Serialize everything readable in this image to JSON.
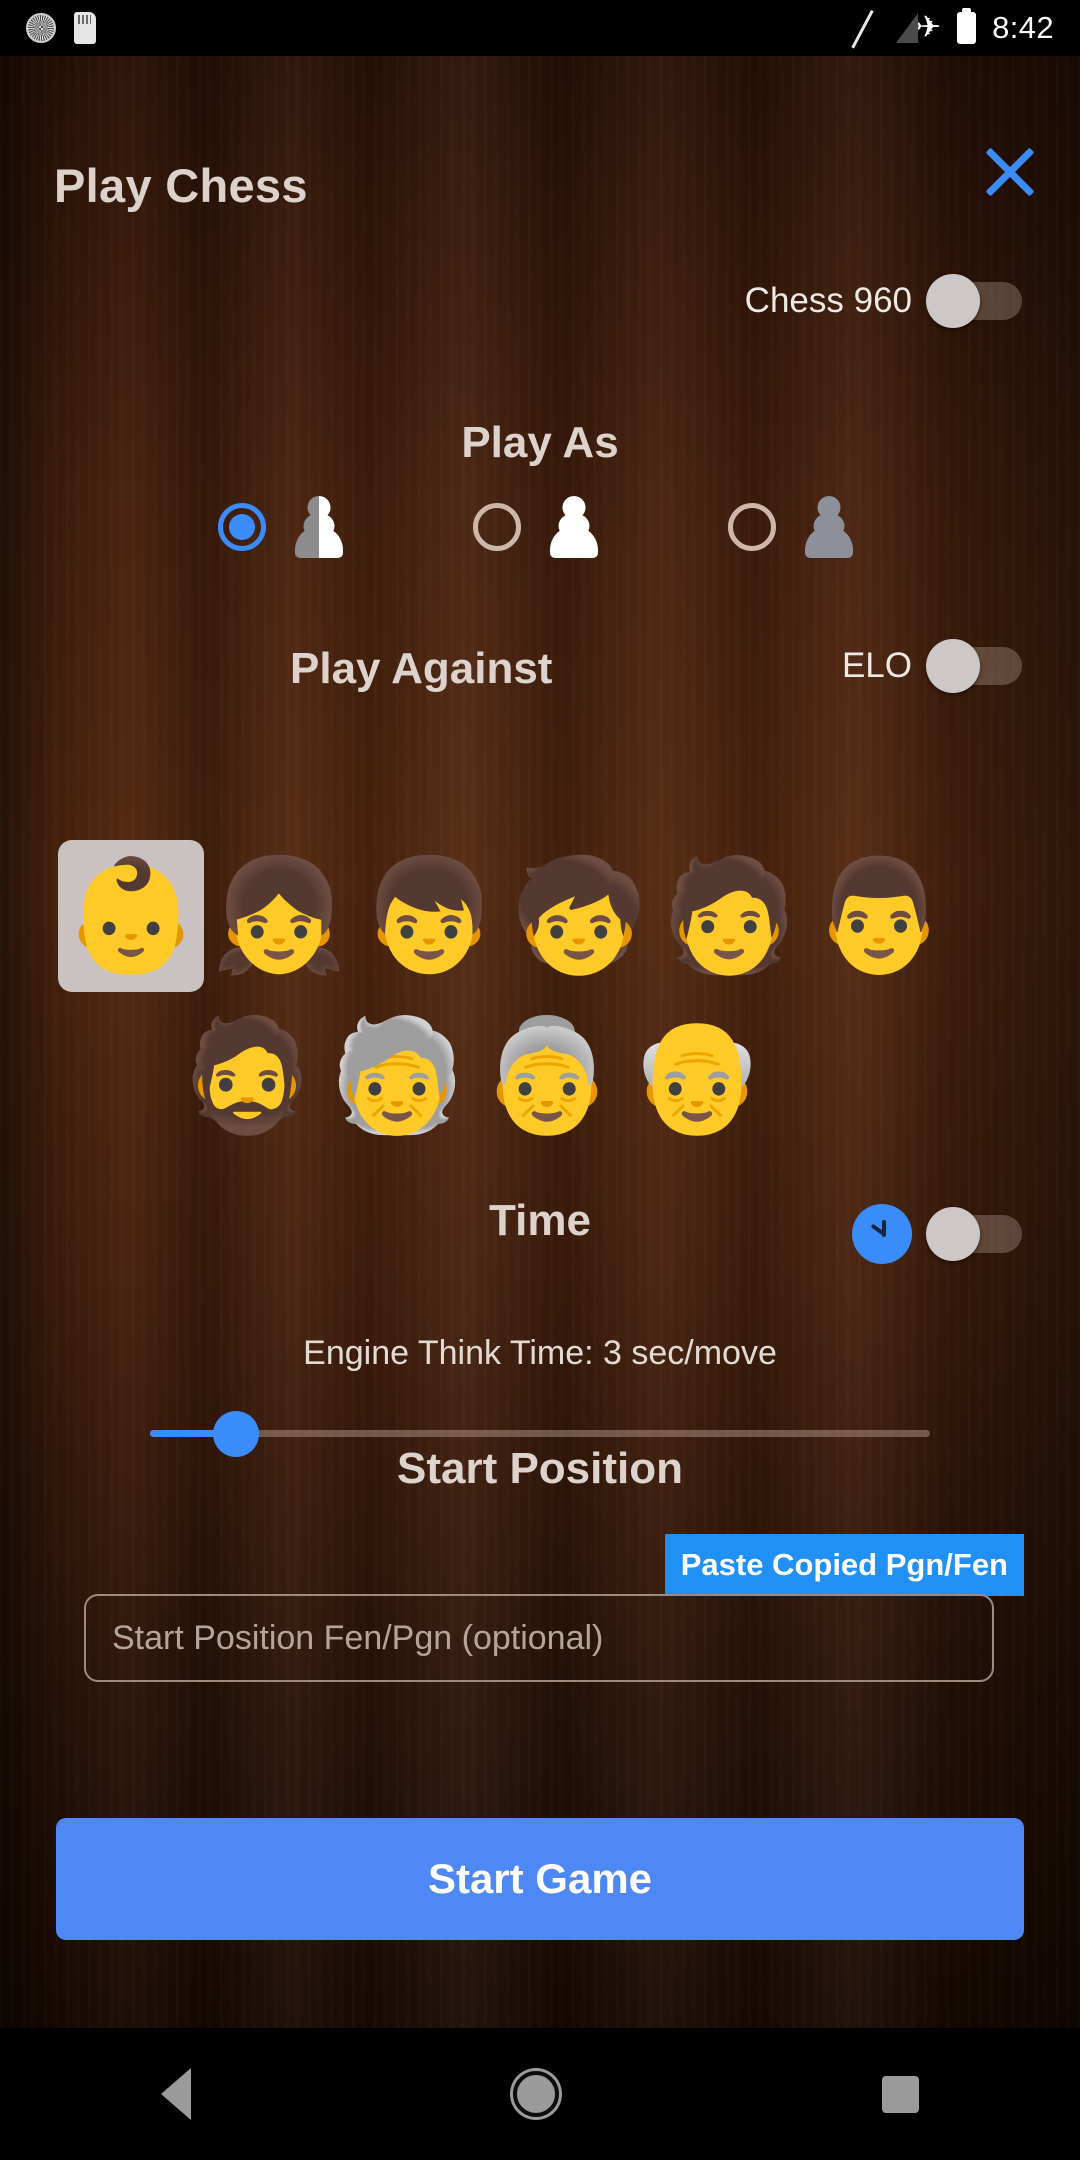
{
  "status_bar": {
    "icons": [
      "clock-icon",
      "sd-card-icon",
      "no-signal-icon",
      "airplane-mode-icon",
      "battery-icon"
    ],
    "time": "8:42"
  },
  "header": {
    "title": "Play Chess",
    "close_label": "✕"
  },
  "chess960": {
    "label": "Chess 960",
    "enabled": false
  },
  "play_as": {
    "heading": "Play As",
    "selected_index": 0,
    "options": [
      {
        "name": "random",
        "piece": "split"
      },
      {
        "name": "white",
        "piece": "white"
      },
      {
        "name": "black",
        "piece": "black"
      }
    ]
  },
  "play_against": {
    "heading": "Play Against",
    "elo_label": "ELO",
    "elo_enabled": false,
    "selected_index": 0,
    "rows": [
      [
        {
          "name": "baby",
          "glyph": "👶"
        },
        {
          "name": "girl",
          "glyph": "👧"
        },
        {
          "name": "boy",
          "glyph": "👦"
        },
        {
          "name": "child",
          "glyph": "🧒"
        },
        {
          "name": "person",
          "glyph": "🧑"
        },
        {
          "name": "man",
          "glyph": "👨"
        }
      ],
      [
        {
          "name": "bearded-man",
          "glyph": "🧔"
        },
        {
          "name": "older-person",
          "glyph": "🧓"
        },
        {
          "name": "old-woman",
          "glyph": "👵"
        },
        {
          "name": "old-man",
          "glyph": "👴"
        }
      ]
    ]
  },
  "time": {
    "heading": "Time",
    "clock_icon": "clock-icon",
    "toggle_enabled": false,
    "think_time_label": "Engine Think Time: 3 sec/move",
    "slider_value": 3,
    "slider_min": 1,
    "slider_max": 22,
    "slider_percent": 11
  },
  "start_position": {
    "heading": "Start Position",
    "paste_label": "Paste Copied Pgn/Fen",
    "input_value": "",
    "input_placeholder": "Start Position Fen/Pgn (optional)"
  },
  "start_game": {
    "label": "Start Game"
  },
  "nav_bar": {
    "back": "back-icon",
    "home": "home-icon",
    "recents": "recents-icon"
  },
  "colors": {
    "accent_blue": "#3b8cfb",
    "button_blue": "#4d88f5",
    "paste_blue": "#2190f5",
    "wood_dark": "#2b1105",
    "wood_mid": "#53280f",
    "heading_text": "#ddd3cc"
  }
}
